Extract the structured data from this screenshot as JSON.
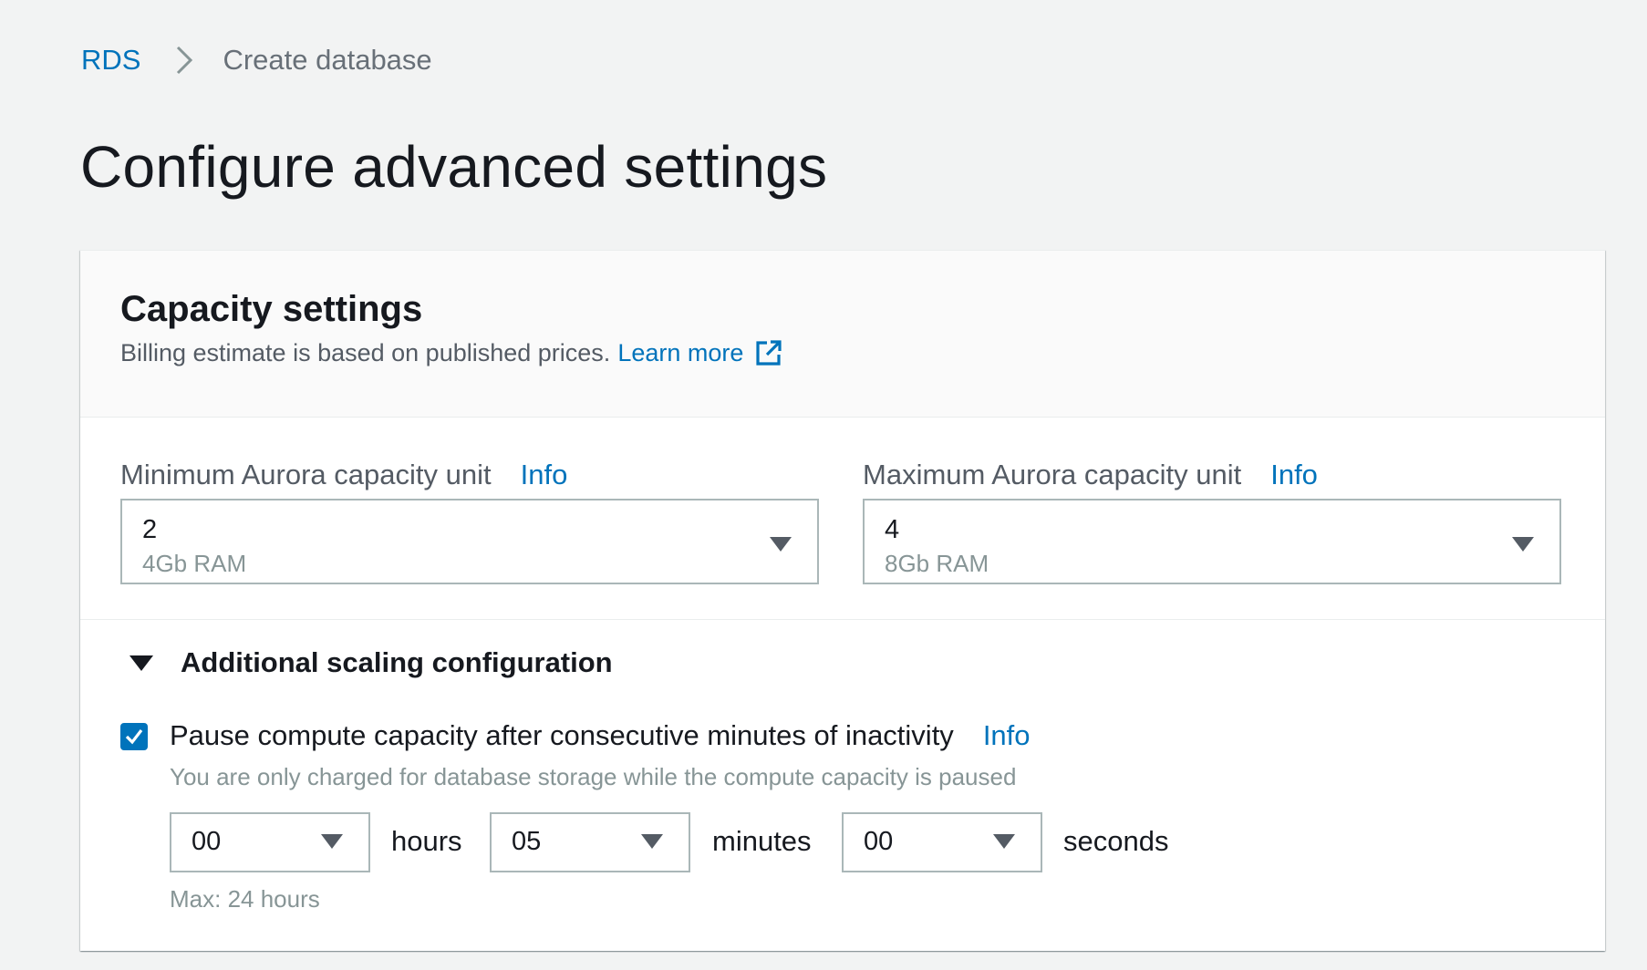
{
  "breadcrumb": {
    "root": "RDS",
    "current": "Create database"
  },
  "page": {
    "title": "Configure advanced settings"
  },
  "capacity": {
    "title": "Capacity settings",
    "description": "Billing estimate is based on published prices.",
    "learn_more": "Learn more",
    "min": {
      "label": "Minimum Aurora capacity unit",
      "info": "Info",
      "value": "2",
      "sub": "4Gb RAM"
    },
    "max": {
      "label": "Maximum Aurora capacity unit",
      "info": "Info",
      "value": "4",
      "sub": "8Gb RAM"
    }
  },
  "scaling": {
    "title": "Additional scaling configuration",
    "pause": {
      "checked": true,
      "label": "Pause compute capacity after consecutive minutes of inactivity",
      "info": "Info",
      "description": "You are only charged for database storage while the compute capacity is paused"
    },
    "hours": {
      "value": "00",
      "unit": "hours"
    },
    "minutes": {
      "value": "05",
      "unit": "minutes"
    },
    "seconds": {
      "value": "00",
      "unit": "seconds"
    },
    "max_note": "Max: 24 hours"
  },
  "colors": {
    "link": "#0073bb",
    "checkbox": "#0073bb",
    "background": "#f2f3f3"
  },
  "icons": {
    "breadcrumb_separator": "chevron-right-icon",
    "external_link": "external-link-icon",
    "dropdown": "caret-down-icon",
    "checkbox": "check-icon"
  }
}
